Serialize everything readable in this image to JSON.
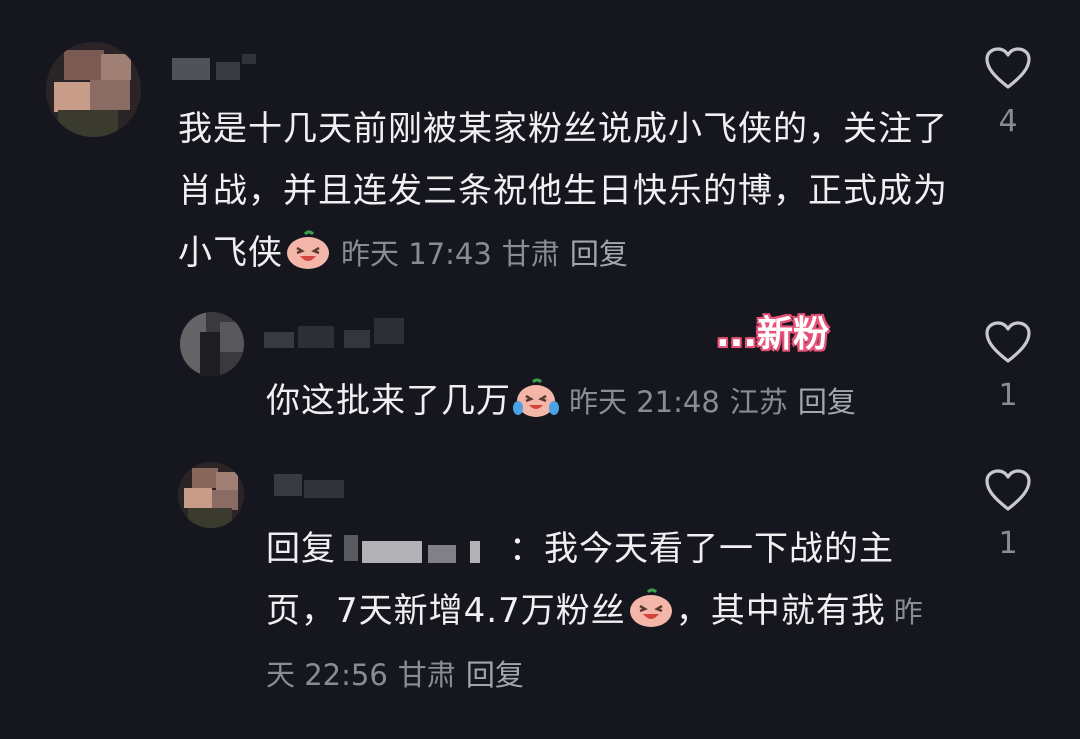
{
  "comments": [
    {
      "text": "我是十几天前刚被某家粉丝说成小飞侠的，关注了肖战，并且连发三条祝他生日快乐的博，正式成为小飞侠",
      "time": "昨天 17:43",
      "location": "甘肃",
      "reply_label": "回复",
      "likes": "4",
      "emoji": "laughing-face-emoji"
    },
    {
      "text": "你这批来了几万",
      "time": "昨天 21:48",
      "location": "江苏",
      "reply_label": "回复",
      "likes": "1",
      "emoji": "crying-laughing-face-emoji"
    },
    {
      "reply_prefix": "回复",
      "text_after_mention": "：我今天看了一下战的主页，7天新增4.7万粉丝",
      "text_tail": "，其中就有我",
      "time": "昨天 22:56",
      "location": "甘肃",
      "reply_label": "回复",
      "likes": "1",
      "emoji": "laughing-face-emoji"
    }
  ],
  "annotation": "...新粉",
  "colors": {
    "background": "#16161e",
    "text": "#f0f0f3",
    "meta": "#8b8b93",
    "annotation_glow": "#e8557a"
  }
}
